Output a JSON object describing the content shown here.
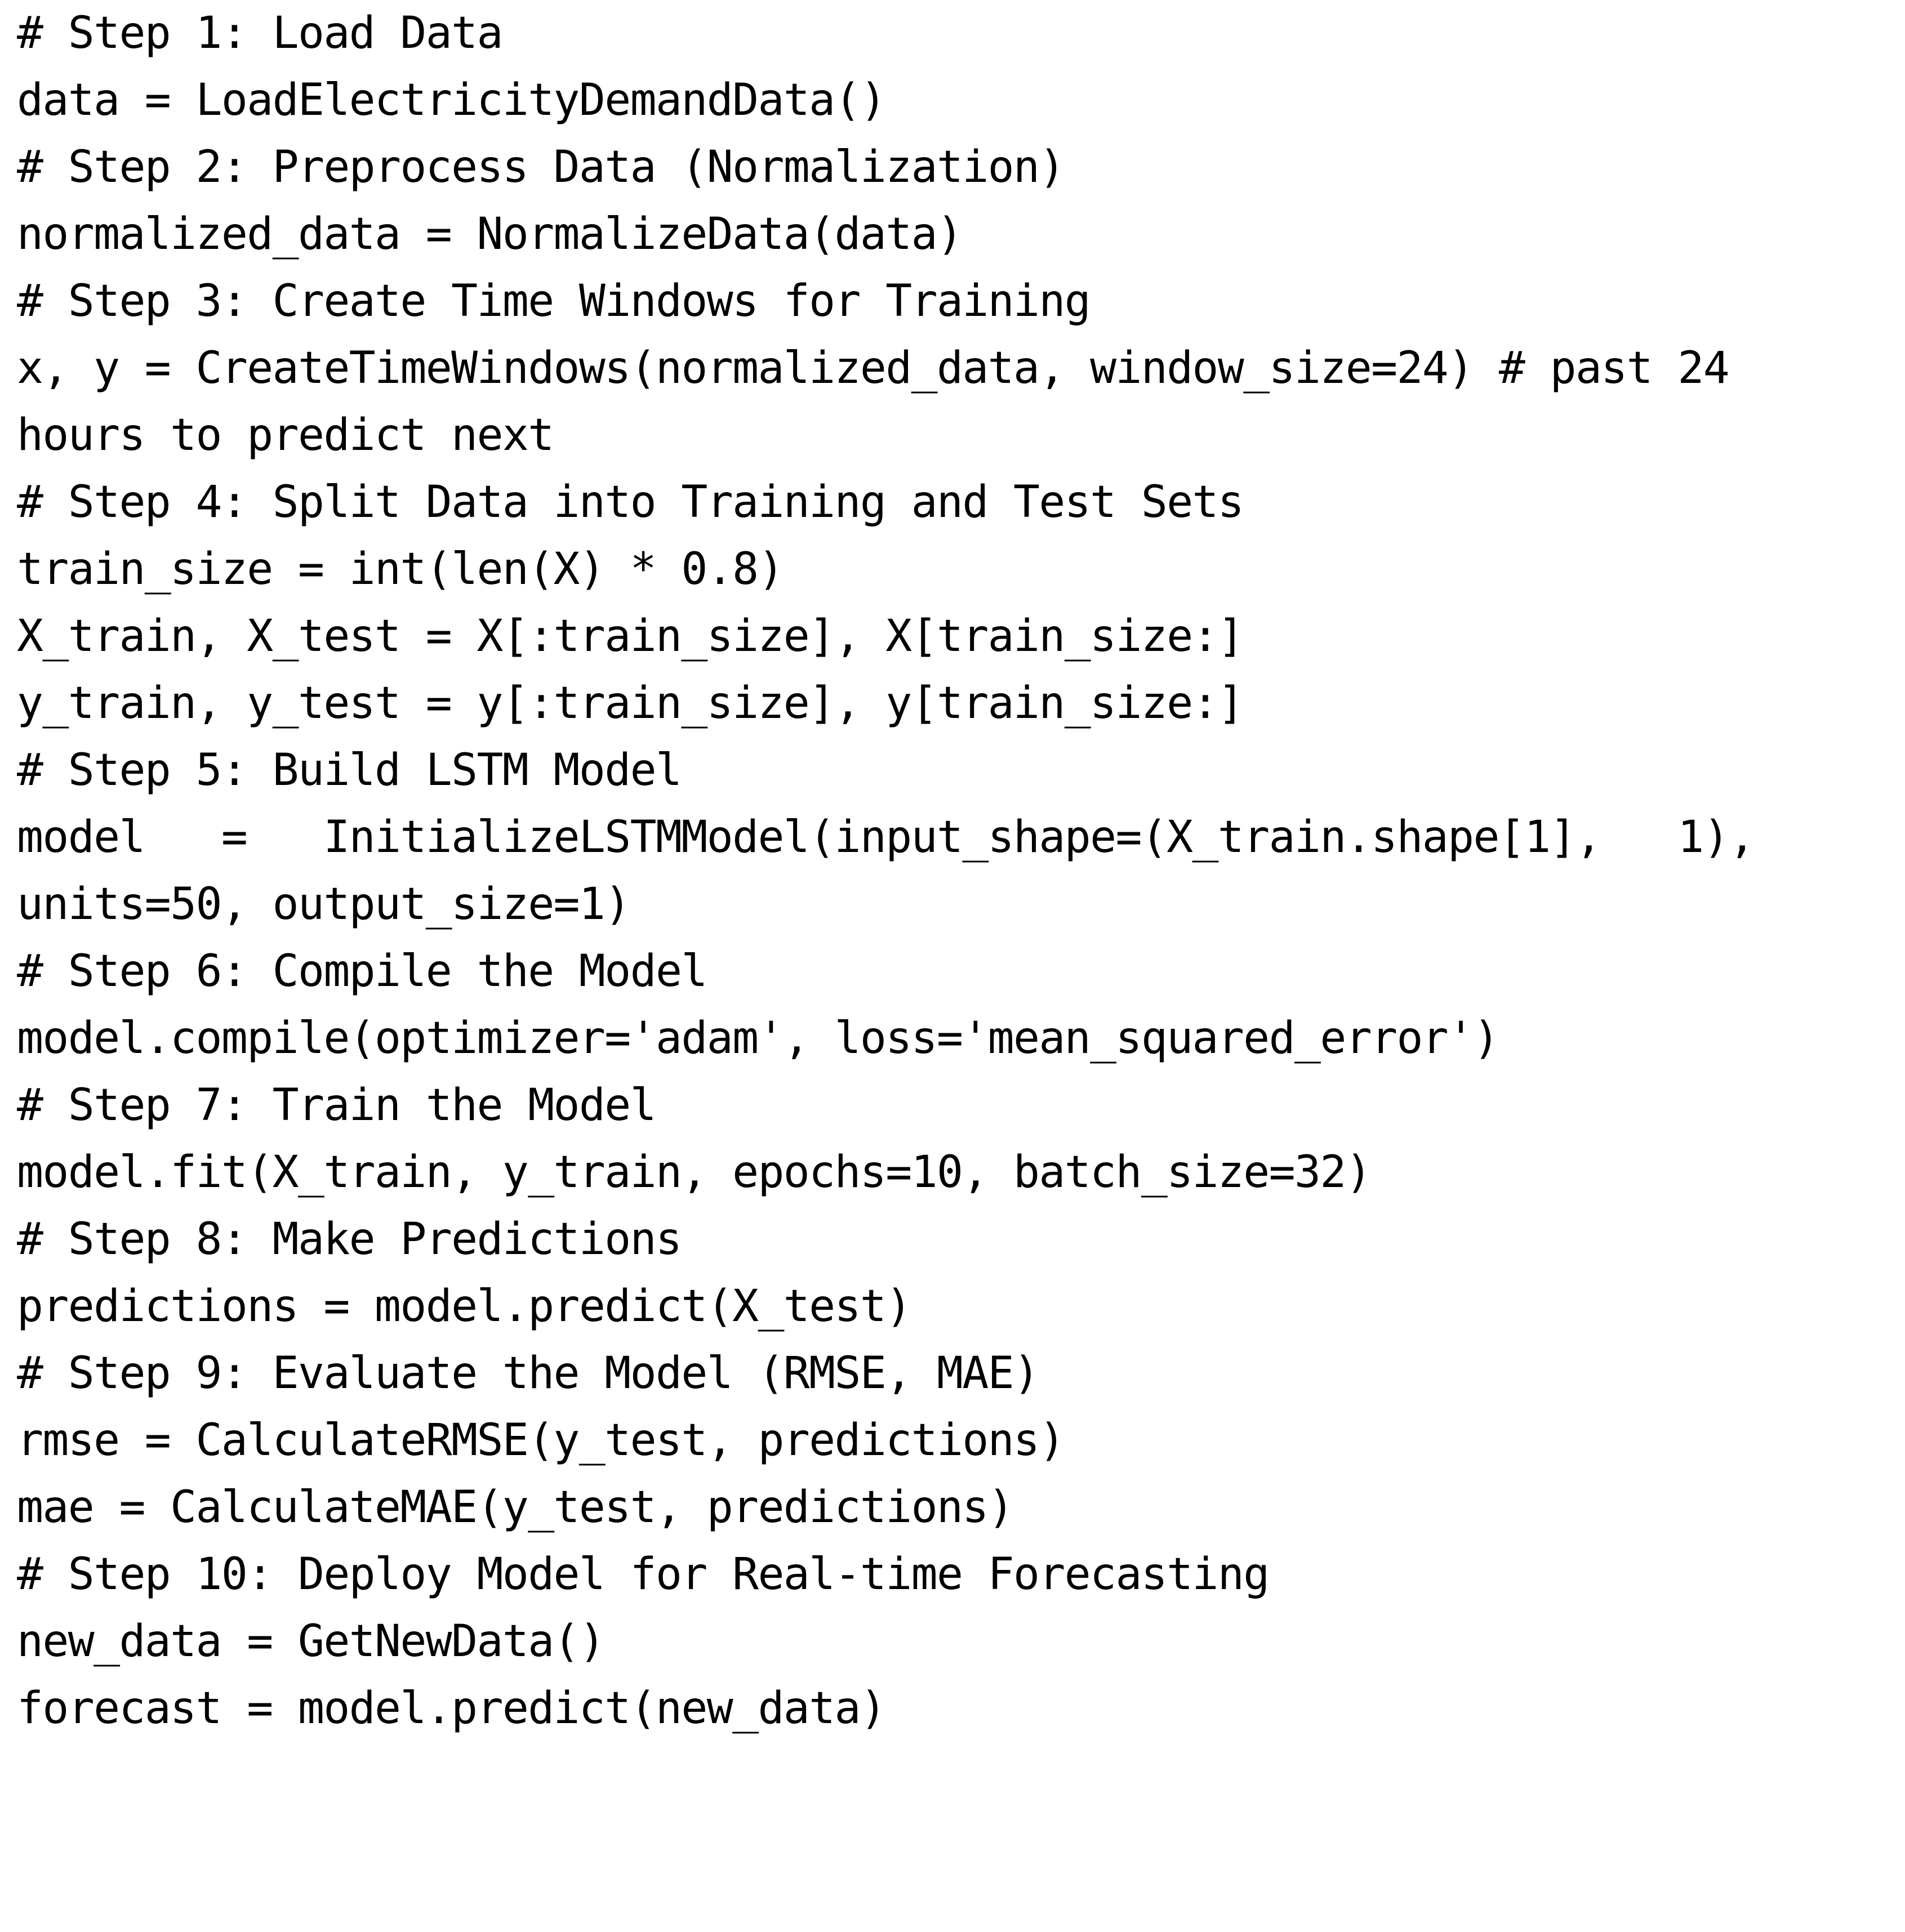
{
  "document": {
    "type": "code-listing",
    "language": "python-pseudocode",
    "background_color": "#ffffff",
    "text_color": "#000000",
    "lines": [
      "# Step 1: Load Data",
      "data = LoadElectricityDemandData()",
      "# Step 2: Preprocess Data (Normalization)",
      "normalized_data = NormalizeData(data)",
      "# Step 3: Create Time Windows for Training",
      "x, y = CreateTimeWindows(normalized_data, window_size=24) # past 24",
      "hours to predict next",
      "# Step 4: Split Data into Training and Test Sets",
      "train_size = int(len(X) * 0.8)",
      "X_train, X_test = X[:train_size], X[train_size:]",
      "y_train, y_test = y[:train_size], y[train_size:]",
      "# Step 5: Build LSTM Model",
      "model   =   InitializeLSTMModel(input_shape=(X_train.shape[1],   1),",
      "units=50, output_size=1)",
      "# Step 6: Compile the Model",
      "model.compile(optimizer='adam', loss='mean_squared_error')",
      "# Step 7: Train the Model",
      "model.fit(X_train, y_train, epochs=10, batch_size=32)",
      "# Step 8: Make Predictions",
      "predictions = model.predict(X_test)",
      "# Step 9: Evaluate the Model (RMSE, MAE)",
      "rmse = CalculateRMSE(y_test, predictions)",
      "mae = CalculateMAE(y_test, predictions)",
      "# Step 10: Deploy Model for Real-time Forecasting",
      "new_data = GetNewData()",
      "forecast = model.predict(new_data)"
    ]
  }
}
